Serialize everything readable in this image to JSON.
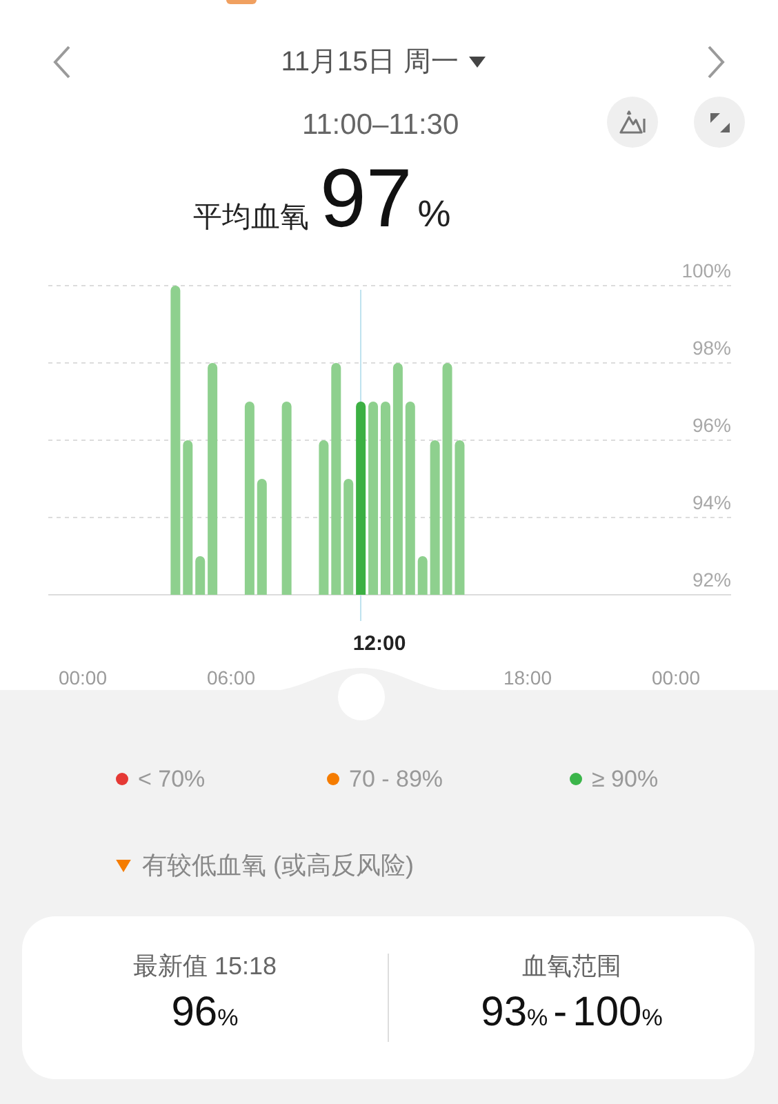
{
  "header": {
    "date": "11月15日 周一"
  },
  "period": {
    "time_range": "11:00–11:30",
    "label": "平均血氧",
    "value": "97",
    "unit": "%"
  },
  "chart": {
    "selected_time_label": "12:00",
    "chart_data": {
      "type": "bar",
      "grid": true,
      "x": [
        3.75,
        4.25,
        4.75,
        5.25,
        6.75,
        7.25,
        8.25,
        9.75,
        10.25,
        10.75,
        11.25,
        11.75,
        12.25,
        12.75,
        13.25,
        13.75,
        14.25,
        14.75,
        15.25
      ],
      "series": [
        {
          "color": "#8ed08e",
          "values": [
            100,
            96,
            93,
            98,
            97,
            95,
            97,
            96,
            98,
            95,
            null,
            97,
            97,
            98,
            97,
            93,
            96,
            98,
            96
          ]
        },
        {
          "color": "#3cb043",
          "values": [
            null,
            null,
            null,
            null,
            null,
            null,
            null,
            null,
            null,
            null,
            97,
            null,
            null,
            null,
            null,
            null,
            null,
            null,
            null
          ]
        }
      ],
      "xlim": [
        0,
        24
      ],
      "ylim": [
        92,
        100
      ],
      "xticks": [
        {
          "value": 0,
          "label": "00:00"
        },
        {
          "value": 6,
          "label": "06:00"
        },
        {
          "value": 18,
          "label": "18:00"
        },
        {
          "value": 24,
          "label": "00:00"
        }
      ],
      "yticks": [
        {
          "value": 100,
          "label": "100%"
        },
        {
          "value": 98,
          "label": "98%"
        },
        {
          "value": 96,
          "label": "96%"
        },
        {
          "value": 94,
          "label": "94%"
        },
        {
          "value": 92,
          "label": "92%"
        }
      ]
    }
  },
  "legend": [
    {
      "label": "< 70%",
      "color": "#e53935"
    },
    {
      "label": "70 - 89%",
      "color": "#f57c00"
    },
    {
      "label": "≥ 90%",
      "color": "#3bb54a"
    }
  ],
  "note": {
    "text": "有较低血氧 (或高反风险)"
  },
  "summary": [
    {
      "label": "最新值 15:18",
      "values": [
        "96"
      ],
      "unit": "%"
    },
    {
      "label": "血氧范围",
      "values": [
        "93",
        "100"
      ],
      "unit": "%",
      "separator": "-"
    }
  ]
}
